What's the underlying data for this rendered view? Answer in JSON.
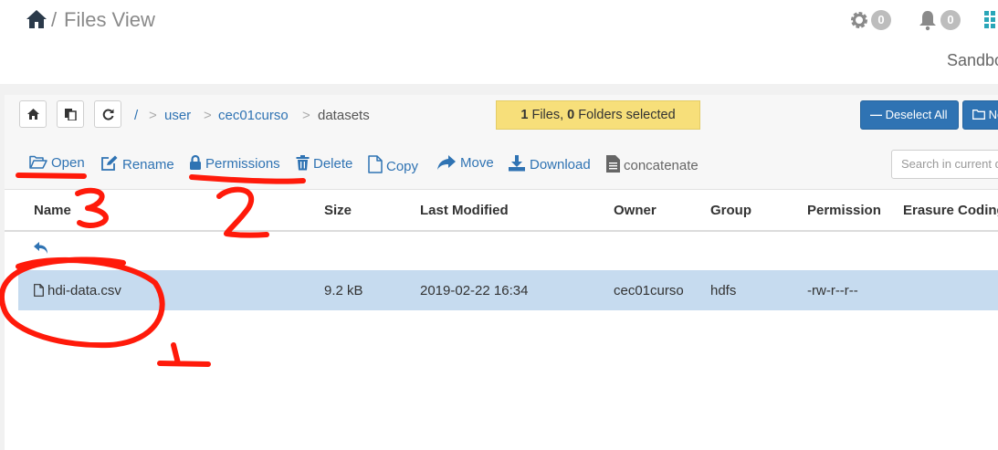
{
  "header": {
    "title": "Files View",
    "separator": "/",
    "settings_count": "0",
    "notifications_count": "0",
    "sandbox_label": "Sandbo"
  },
  "breadcrumb": {
    "root": "/",
    "sep": ">",
    "items": [
      "user",
      "cec01curso",
      "datasets"
    ]
  },
  "selection": {
    "files": "1",
    "files_label": " Files, ",
    "folders": "0",
    "folders_label": " Folders selected"
  },
  "buttons": {
    "deselect_all": "Deselect All",
    "new_folder": "Ne"
  },
  "actions": {
    "open": "Open",
    "rename": "Rename",
    "permissions": "Permissions",
    "delete": "Delete",
    "copy": "Copy",
    "move": "Move",
    "download": "Download",
    "concatenate": "concatenate"
  },
  "search": {
    "placeholder": "Search in current d"
  },
  "table": {
    "headers": [
      "Name",
      "Size",
      "Last Modified",
      "Owner",
      "Group",
      "Permission",
      "Erasure Coding"
    ],
    "rows": [
      {
        "name": "hdi-data.csv",
        "size": "9.2 kB",
        "modified": "2019-02-22 16:34",
        "owner": "cec01curso",
        "group": "hdfs",
        "permission": "-rw-r--r--"
      }
    ]
  },
  "annotations": {
    "mark1": "1",
    "mark2": "2",
    "mark3": "3",
    "color": "#ff1a0a"
  },
  "colors": {
    "link": "#2f73b3",
    "selected_row": "#c6dbef",
    "highlight": "#f7df7a"
  }
}
